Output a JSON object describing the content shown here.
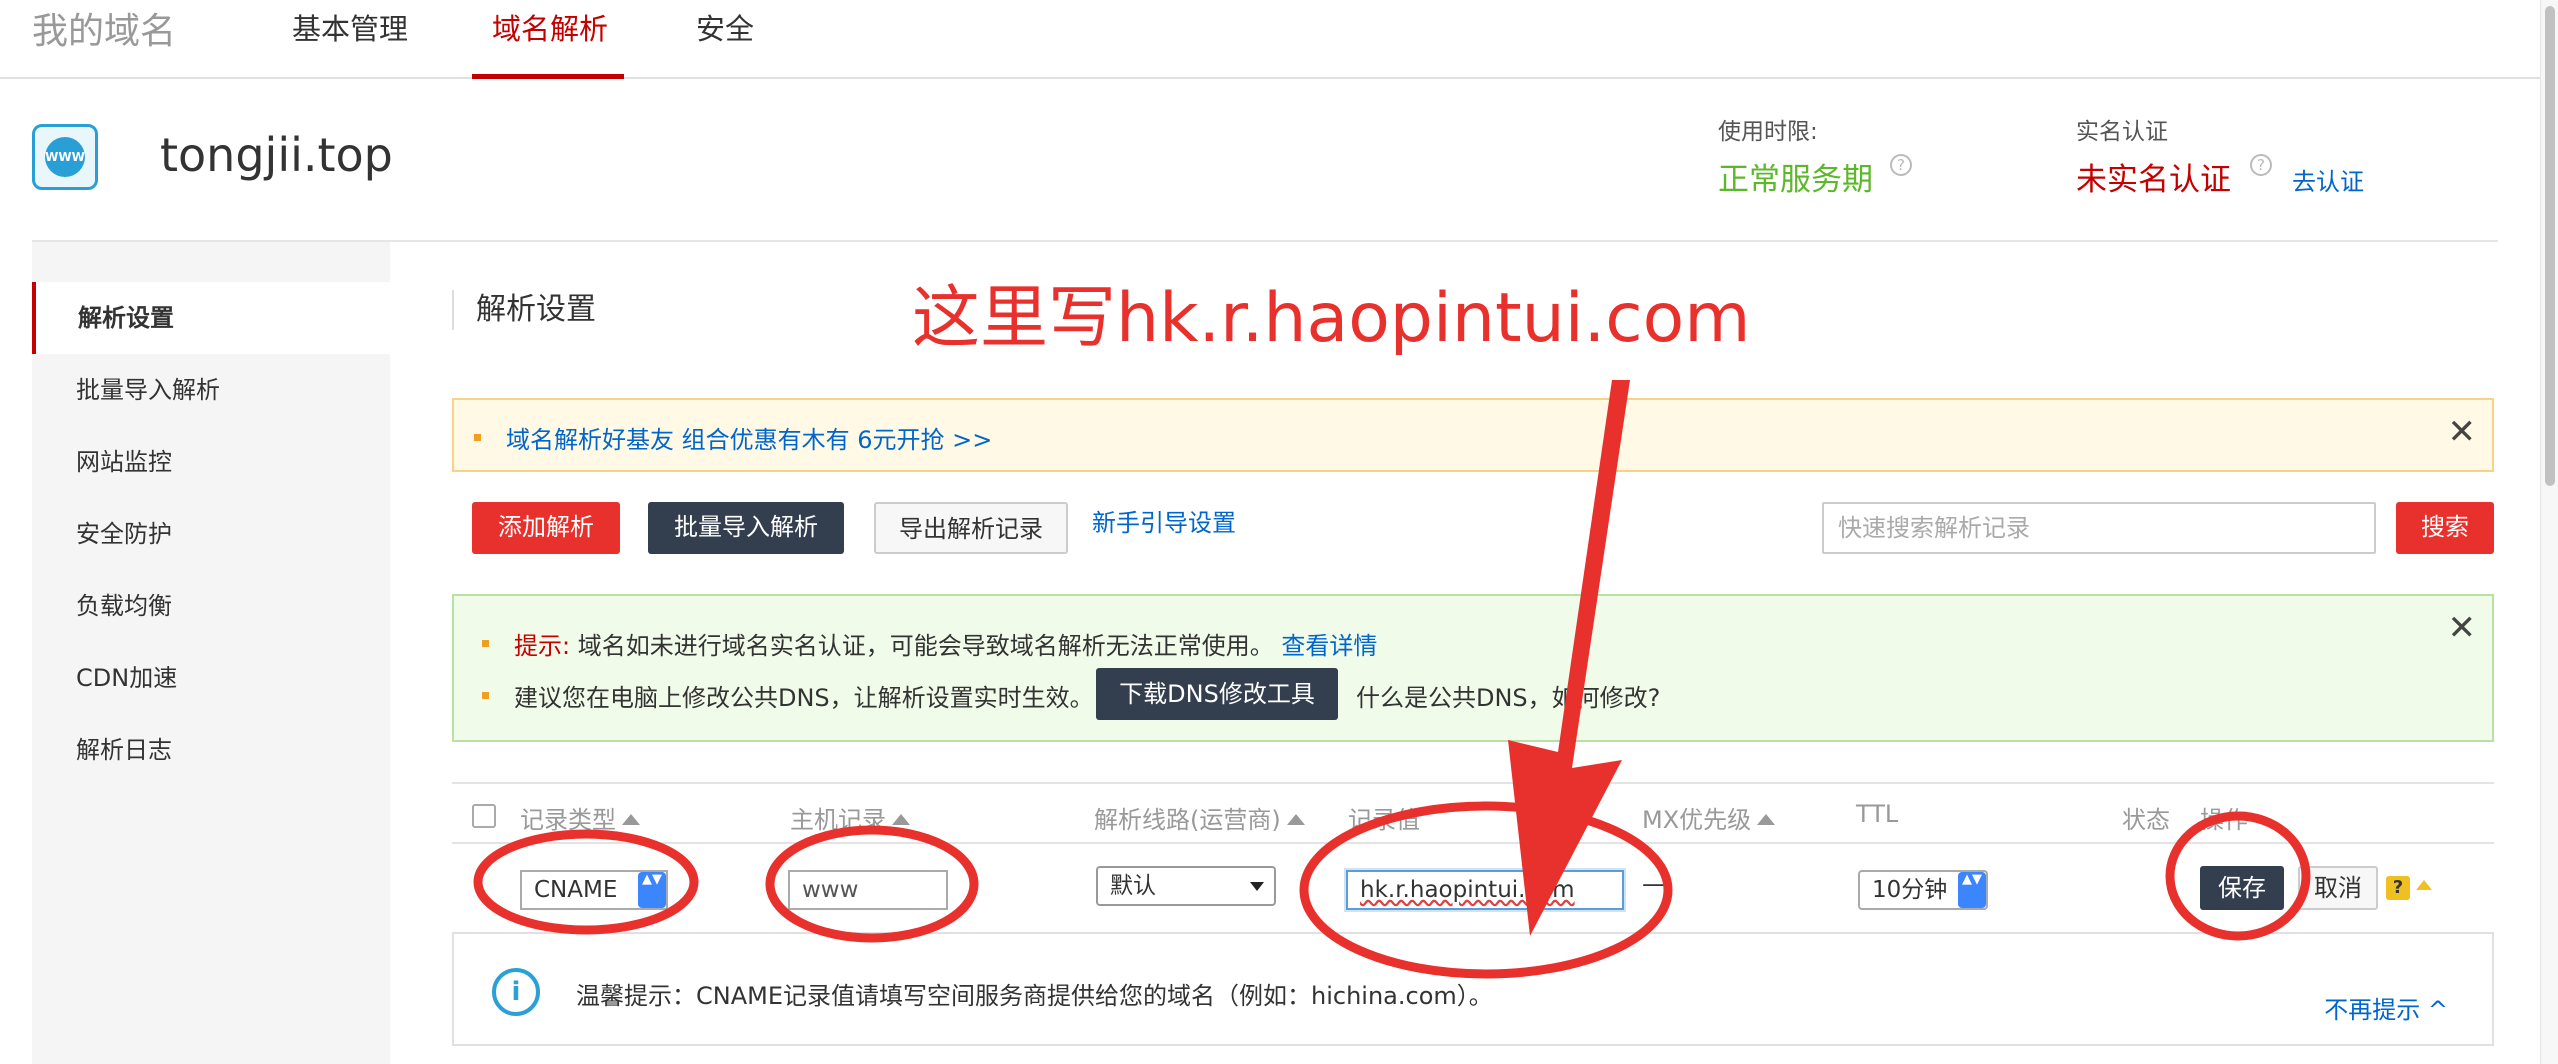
{
  "topnav": {
    "brand": "我的域名",
    "tabs": [
      "基本管理",
      "域名解析",
      "安全"
    ],
    "active_tab": "域名解析"
  },
  "domain": {
    "logo_text": "WWW",
    "name": "tongjii.top",
    "period_label": "使用时限:",
    "period_value": "正常服务期",
    "verify_label": "实名认证",
    "verify_value": "未实名认证",
    "verify_link": "去认证",
    "help_glyph": "?"
  },
  "sidebar": {
    "items": [
      "解析设置",
      "批量导入解析",
      "网站监控",
      "安全防护",
      "负载均衡",
      "CDN加速",
      "解析日志"
    ],
    "active": "解析设置"
  },
  "main": {
    "title": "解析设置",
    "annotation": "这里写hk.r.haopintui.com",
    "promo_text": "域名解析好基友 组合优惠有木有 6元开抢 >>",
    "close_glyph": "✕"
  },
  "toolbar": {
    "add": "添加解析",
    "batch_import": "批量导入解析",
    "export": "导出解析记录",
    "guide": "新手引导设置",
    "search_placeholder": "快速搜索解析记录",
    "search": "搜索"
  },
  "notice": {
    "tip_label": "提示:",
    "tip_text": "域名如未进行域名实名认证，可能会导致域名解析无法正常使用。",
    "tip_link": "查看详情",
    "dns_text": "建议您在电脑上修改公共DNS，让解析设置实时生效。",
    "dns_button": "下载DNS修改工具",
    "dns_link": "什么是公共DNS，如何修改?"
  },
  "table": {
    "headers": {
      "type": "记录类型",
      "host": "主机记录",
      "line": "解析线路(运营商)",
      "value": "记录值",
      "mx": "MX优先级",
      "ttl": "TTL",
      "status": "状态",
      "action": "操作"
    },
    "row": {
      "type": "CNAME",
      "host": "www",
      "line": "默认",
      "value": "hk.r.haopintui.com",
      "mx": "—",
      "ttl": "10分钟",
      "save": "保存",
      "cancel": "取消",
      "help_glyph": "?",
      "select_arrows": "▲▼"
    }
  },
  "warm_tip": {
    "icon_glyph": "i",
    "text": "温馨提示：CNAME记录值请填写空间服务商提供给您的域名（例如：hichina.com）。",
    "dismiss": "不再提示 ^"
  },
  "colors": {
    "brand_red": "#c40000",
    "annotation_red": "#e8312d",
    "ok_green": "#5cb82a",
    "link_blue": "#0066cc",
    "dark_button": "#333f4f"
  }
}
